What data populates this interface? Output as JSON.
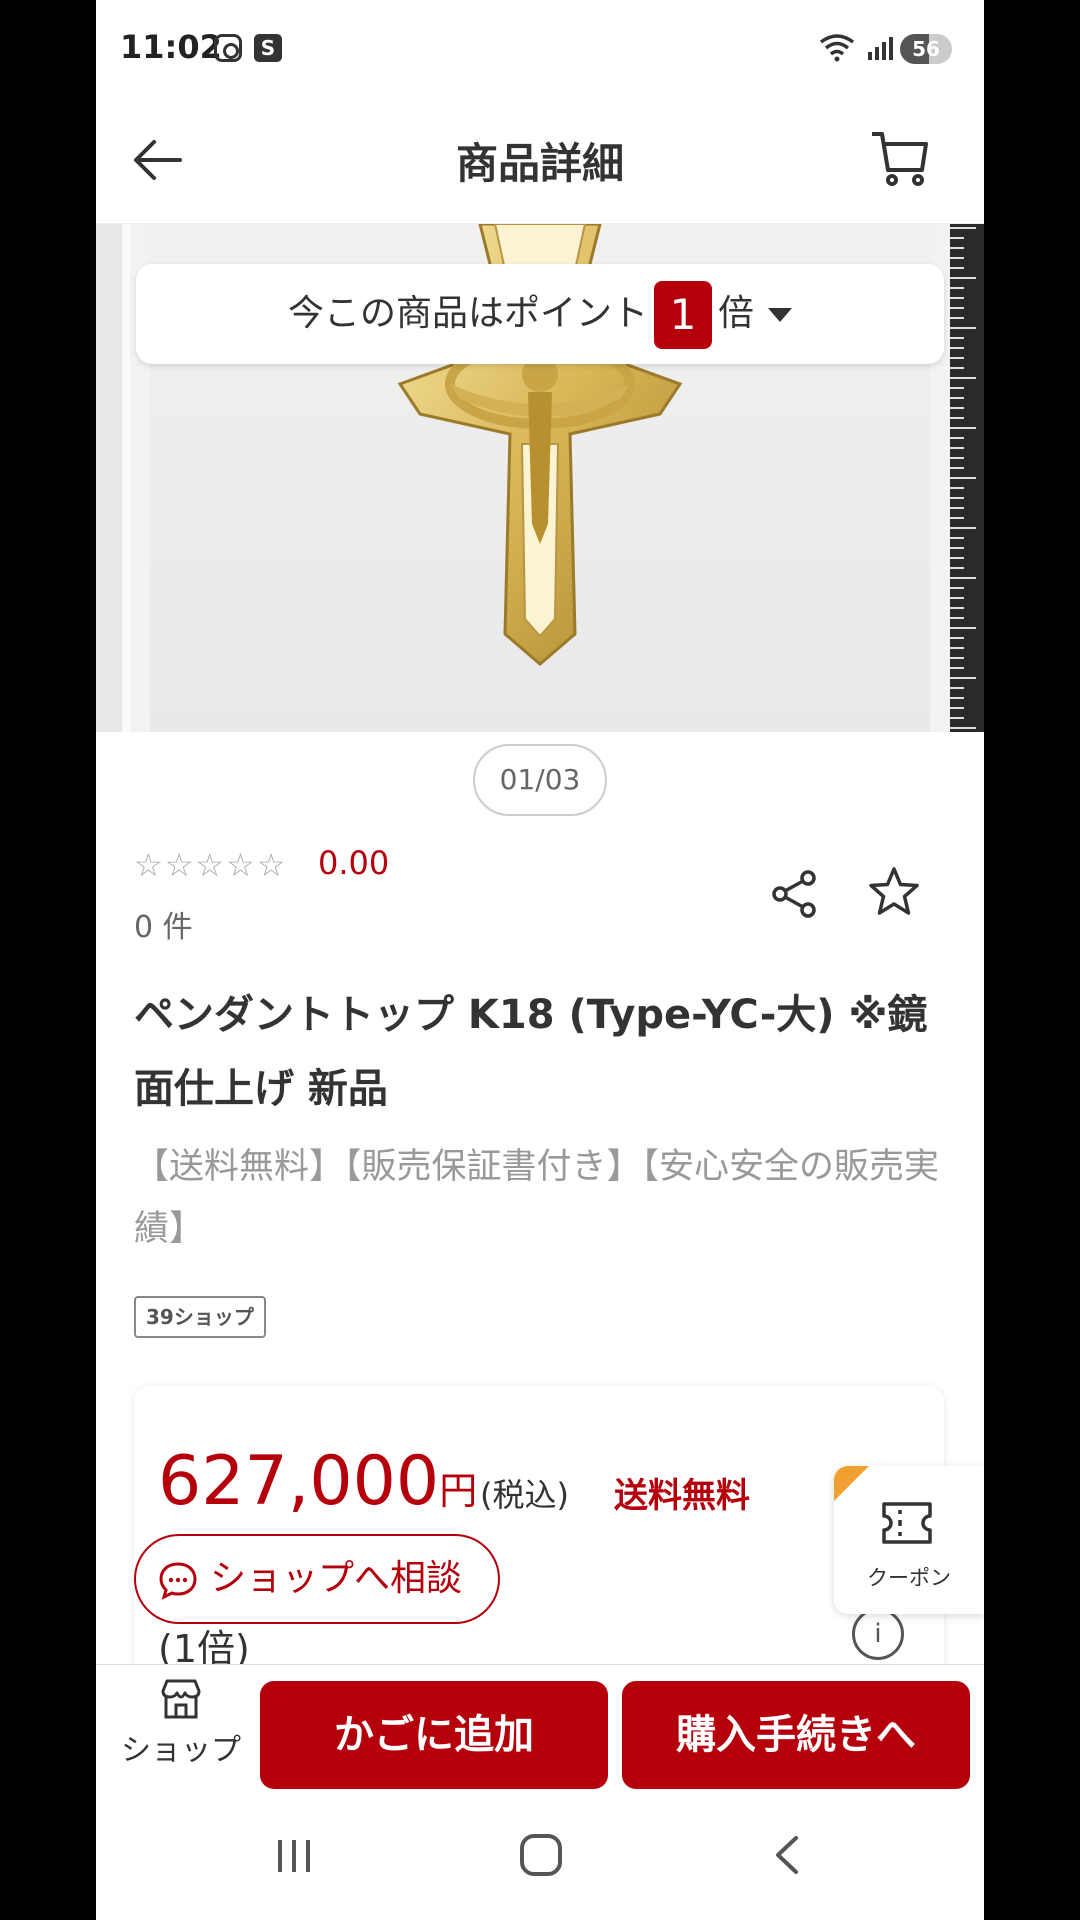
{
  "status_bar": {
    "time": "11:02",
    "app_badge": "S",
    "battery": "56",
    "battery_level": 0.56
  },
  "header": {
    "title": "商品詳細"
  },
  "points_banner": {
    "prefix": "今この商品はポイント",
    "multiplier": "1",
    "suffix": "倍"
  },
  "gallery": {
    "pager": "01/03"
  },
  "rating": {
    "stars": "☆☆☆☆☆",
    "value": "0.00",
    "count": "0 件"
  },
  "product": {
    "title": "ペンダントトップ K18 (Type-YC-大) ※鏡面仕上げ 新品",
    "subtitle": "【送料無料】【販売保証書付き】【安心安全の販売実績】",
    "tag": "39ショップ"
  },
  "price": {
    "amount": "627,000",
    "unit": "円",
    "tax": "(税込)",
    "shipping": "送料無料",
    "multiplier_label": "(1倍)",
    "info_glyph": "i"
  },
  "consult_button": {
    "label": "ショップへ相談"
  },
  "coupon": {
    "label": "クーポン"
  },
  "bottom_bar": {
    "shop_label": "ショップ",
    "add_to_cart": "かごに追加",
    "checkout": "購入手続きへ"
  },
  "colors": {
    "accent": "#b5000c",
    "coupon_corner": "#f0a030"
  },
  "icons": [
    "back-arrow-icon",
    "cart-icon",
    "share-icon",
    "star-outline-icon",
    "chat-icon",
    "ticket-icon",
    "shop-icon",
    "info-icon"
  ]
}
